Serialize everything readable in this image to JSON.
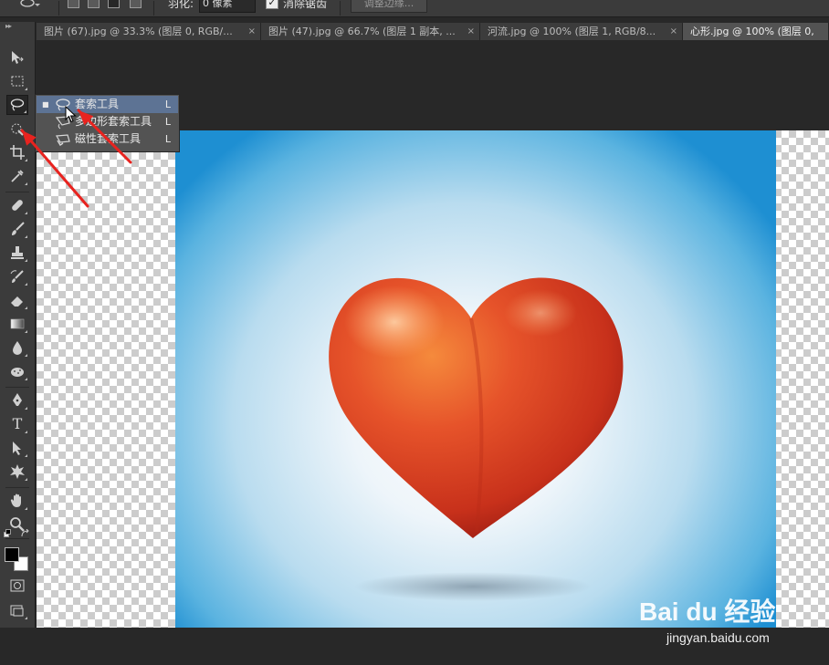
{
  "options_bar": {
    "feather_label": "羽化:",
    "feather_value": "0 像素",
    "antialias_checked": true,
    "antialias_label": "消除锯齿",
    "refine_edge_label": "调整边缘..."
  },
  "tabs": [
    {
      "label": "图片 (67).jpg @ 33.3% (图层 0, RGB/...",
      "active": false
    },
    {
      "label": "图片 (47).jpg @ 66.7% (图层 1 副本, ...",
      "active": false
    },
    {
      "label": "河流.jpg @ 100% (图层 1, RGB/8...",
      "active": false
    },
    {
      "label": "心形.jpg @ 100% (图层 0,",
      "active": true
    }
  ],
  "tab_close_glyph": "×",
  "toolbox": {
    "grip": "▸▸",
    "tools": [
      {
        "name": "move-tool",
        "icon": "move-icon"
      },
      {
        "name": "marquee-tool",
        "icon": "rect-marquee-icon"
      },
      {
        "name": "lasso-tool",
        "icon": "lasso-icon",
        "active": true
      },
      {
        "name": "quick-selection-tool",
        "icon": "quick-select-icon"
      },
      {
        "name": "crop-tool",
        "icon": "crop-icon"
      },
      {
        "name": "eyedropper-tool",
        "icon": "eyedropper-icon"
      },
      {
        "name": "healing-brush-tool",
        "icon": "bandage-icon"
      },
      {
        "name": "brush-tool",
        "icon": "brush-icon"
      },
      {
        "name": "clone-stamp-tool",
        "icon": "stamp-icon"
      },
      {
        "name": "history-brush-tool",
        "icon": "history-brush-icon"
      },
      {
        "name": "eraser-tool",
        "icon": "eraser-icon"
      },
      {
        "name": "gradient-tool",
        "icon": "gradient-icon"
      },
      {
        "name": "blur-tool",
        "icon": "drop-icon"
      },
      {
        "name": "dodge-tool",
        "icon": "sponge-icon"
      },
      {
        "name": "pen-tool",
        "icon": "pen-icon"
      },
      {
        "name": "type-tool",
        "icon": "type-icon",
        "glyph": "T"
      },
      {
        "name": "path-selection-tool",
        "icon": "arrow-icon"
      },
      {
        "name": "shape-tool",
        "icon": "custom-shape-icon"
      },
      {
        "name": "hand-tool",
        "icon": "hand-icon"
      },
      {
        "name": "zoom-tool",
        "icon": "zoom-icon"
      }
    ],
    "foreground_color": "#000000",
    "background_color": "#ffffff"
  },
  "flyout": {
    "items": [
      {
        "label": "套索工具",
        "shortcut": "L",
        "selected": true,
        "icon": "lasso-icon"
      },
      {
        "label": "多边形套索工具",
        "shortcut": "L",
        "selected": false,
        "icon": "polygonal-lasso-icon"
      },
      {
        "label": "磁性套索工具",
        "shortcut": "L",
        "selected": false,
        "icon": "magnetic-lasso-icon"
      }
    ],
    "bullet": "■"
  },
  "watermark": {
    "brand": "Bai du 经验",
    "url": "jingyan.baidu.com"
  },
  "colors": {
    "annotation_arrow": "#e8231f",
    "heart": "#d8421f",
    "sky": "#1e8fd2",
    "selected_item": "#5d7394"
  }
}
